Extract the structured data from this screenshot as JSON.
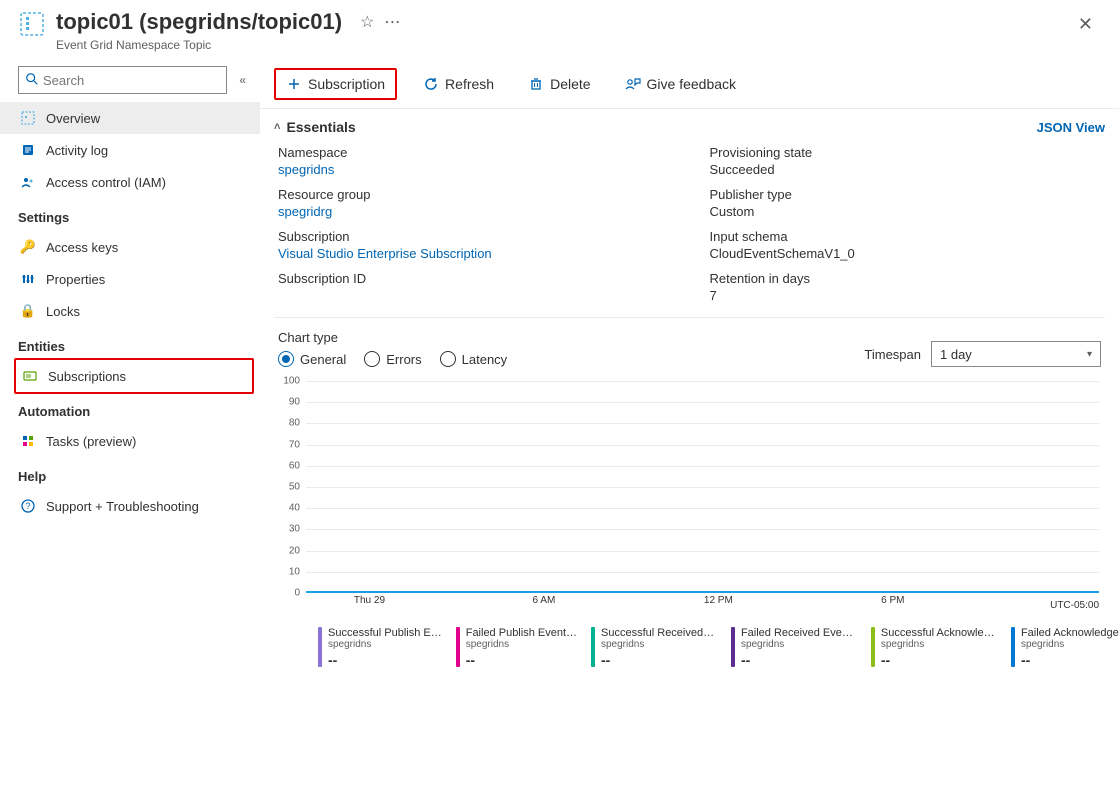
{
  "header": {
    "title": "topic01 (spegridns/topic01)",
    "subtitle": "Event Grid Namespace Topic"
  },
  "sidebar": {
    "search_placeholder": "Search",
    "items": {
      "overview": "Overview",
      "activity_log": "Activity log",
      "access_control": "Access control (IAM)"
    },
    "settings_label": "Settings",
    "settings": {
      "access_keys": "Access keys",
      "properties": "Properties",
      "locks": "Locks"
    },
    "entities_label": "Entities",
    "entities": {
      "subscriptions": "Subscriptions"
    },
    "automation_label": "Automation",
    "automation": {
      "tasks": "Tasks (preview)"
    },
    "help_label": "Help",
    "help": {
      "support": "Support + Troubleshooting"
    }
  },
  "toolbar": {
    "subscription": "Subscription",
    "refresh": "Refresh",
    "delete": "Delete",
    "feedback": "Give feedback"
  },
  "essentials": {
    "title": "Essentials",
    "json_view": "JSON View",
    "left": [
      {
        "label": "Namespace",
        "value": "spegridns",
        "link": true
      },
      {
        "label": "Resource group",
        "value": "spegridrg",
        "link": true
      },
      {
        "label": "Subscription",
        "value": "Visual Studio Enterprise Subscription",
        "link": true
      },
      {
        "label": "Subscription ID",
        "value": "",
        "link": false
      }
    ],
    "right": [
      {
        "label": "Provisioning state",
        "value": "Succeeded"
      },
      {
        "label": "Publisher type",
        "value": "Custom"
      },
      {
        "label": "Input schema",
        "value": "CloudEventSchemaV1_0"
      },
      {
        "label": "Retention in days",
        "value": "7"
      }
    ]
  },
  "chart_controls": {
    "chart_type_label": "Chart type",
    "radios": {
      "general": "General",
      "errors": "Errors",
      "latency": "Latency"
    },
    "timespan_label": "Timespan",
    "timespan_value": "1 day"
  },
  "chart_data": {
    "type": "line",
    "title": "",
    "xlabel": "",
    "ylabel": "",
    "ylim": [
      0,
      100
    ],
    "y_ticks": [
      0,
      10,
      20,
      30,
      40,
      50,
      60,
      70,
      80,
      90,
      100
    ],
    "x_ticks": [
      "Thu 29",
      "6 AM",
      "12 PM",
      "6 PM"
    ],
    "utc": "UTC-05:00",
    "series": [
      {
        "name": "Successful Publish E…",
        "sub": "spegridns",
        "value": "--",
        "color": "#8b74d6"
      },
      {
        "name": "Failed Publish Event…",
        "sub": "spegridns",
        "value": "--",
        "color": "#e3008c"
      },
      {
        "name": "Successful Received …",
        "sub": "spegridns",
        "value": "--",
        "color": "#00b294"
      },
      {
        "name": "Failed Received Even…",
        "sub": "spegridns",
        "value": "--",
        "color": "#5c2e91"
      },
      {
        "name": "Successful Acknowled…",
        "sub": "spegridns",
        "value": "--",
        "color": "#8cbd18"
      },
      {
        "name": "Failed Acknowledged …",
        "sub": "spegridns",
        "value": "--",
        "color": "#0078d4"
      }
    ],
    "flatline_value": 0
  }
}
